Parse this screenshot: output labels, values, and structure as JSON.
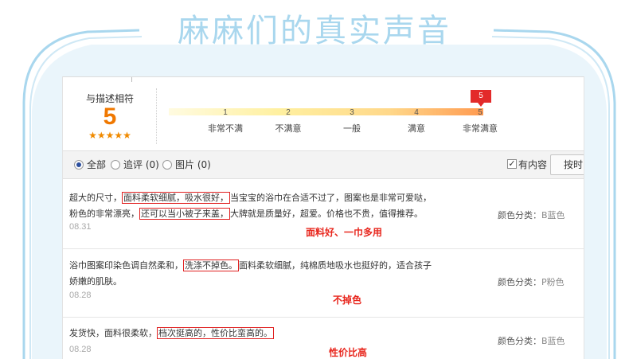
{
  "headline": "麻麻们的真实声音",
  "rating": {
    "label": "与描述相符",
    "score": "5",
    "stars": "★★★★★",
    "scale_numbers": [
      "1",
      "2",
      "3",
      "4",
      "5"
    ],
    "scale_labels": [
      "非常不满",
      "不满意",
      "一般",
      "满意",
      "非常满意"
    ],
    "marker_value": "5"
  },
  "filters": {
    "all": "全部",
    "followup": "追评 (0)",
    "images": "图片 (0)",
    "has_content": "有内容",
    "sort_button": "按时"
  },
  "colors": {
    "accent": "#f07800",
    "highlight_border": "#e02020",
    "annotation": "#e8271e",
    "headline": "#a9d7ee"
  },
  "reviews": [
    {
      "line1_a": "超大的尺寸，",
      "line1_hl": "面料柔软细腻，吸水很好，",
      "line1_b": "当宝宝的浴巾在合适不过了，图案也是非常可爱哒，",
      "line2_a": "粉色的非常漂亮，",
      "line2_hl": "还可以当小被子来盖，",
      "line2_b": "大牌就是质量好，超爱。价格也不贵，值得推荐。",
      "date": "08.31",
      "spec_label": "颜色分类：",
      "spec_value": "B蓝色",
      "annotation": "面料好、一巾多用"
    },
    {
      "line1_a": "浴巾图案印染色调自然柔和，",
      "line1_hl": "洗涤不掉色。",
      "line1_b": "面料柔软细腻，纯棉质地吸水也挺好的，适合孩子",
      "line2_a": "娇嫩的肌肤。",
      "date": "08.28",
      "spec_label": "颜色分类：",
      "spec_value": "P粉色",
      "annotation": "不掉色"
    },
    {
      "line1_a": "发货快，面料很柔软，",
      "line1_hl": "档次挺高的，性价比蛮高的。",
      "date": "08.28",
      "spec_label": "颜色分类：",
      "spec_value": "B蓝色",
      "annotation": "性价比高"
    }
  ]
}
